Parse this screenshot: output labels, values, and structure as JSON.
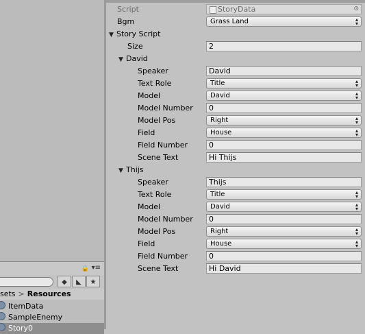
{
  "project": {
    "lock_icon": "lock-icon",
    "menu_icon": "menu-icon",
    "breadcrumb": {
      "parent": "sets",
      "separator": ">",
      "current": "Resources"
    },
    "assets": [
      {
        "name": "ItemData",
        "selected": false
      },
      {
        "name": "SampleEnemy",
        "selected": false
      },
      {
        "name": "Story0",
        "selected": true
      }
    ],
    "toolbar_icons": [
      "scene-type-icon",
      "tag-icon",
      "star-icon"
    ]
  },
  "inspector": {
    "script": {
      "label": "Script",
      "value": "StoryData"
    },
    "bgm": {
      "label": "Bgm",
      "value": "Grass Land"
    },
    "story_script": {
      "label": "Story Script",
      "size_label": "Size",
      "size_value": "2"
    },
    "elements": [
      {
        "name": "David",
        "speaker": {
          "label": "Speaker",
          "value": "David"
        },
        "text_role": {
          "label": "Text Role",
          "value": "Title"
        },
        "model": {
          "label": "Model",
          "value": "David"
        },
        "model_number": {
          "label": "Model Number",
          "value": "0"
        },
        "model_pos": {
          "label": "Model Pos",
          "value": "Right"
        },
        "field": {
          "label": "Field",
          "value": "House"
        },
        "field_number": {
          "label": "Field Number",
          "value": "0"
        },
        "scene_text": {
          "label": "Scene Text",
          "value": "Hi Thijs"
        }
      },
      {
        "name": "Thijs",
        "speaker": {
          "label": "Speaker",
          "value": "Thijs"
        },
        "text_role": {
          "label": "Text Role",
          "value": "Title"
        },
        "model": {
          "label": "Model",
          "value": "David"
        },
        "model_number": {
          "label": "Model Number",
          "value": "0"
        },
        "model_pos": {
          "label": "Model Pos",
          "value": "Right"
        },
        "field": {
          "label": "Field",
          "value": "House"
        },
        "field_number": {
          "label": "Field Number",
          "value": "0"
        },
        "scene_text": {
          "label": "Scene Text",
          "value": "Hi David"
        }
      }
    ]
  }
}
